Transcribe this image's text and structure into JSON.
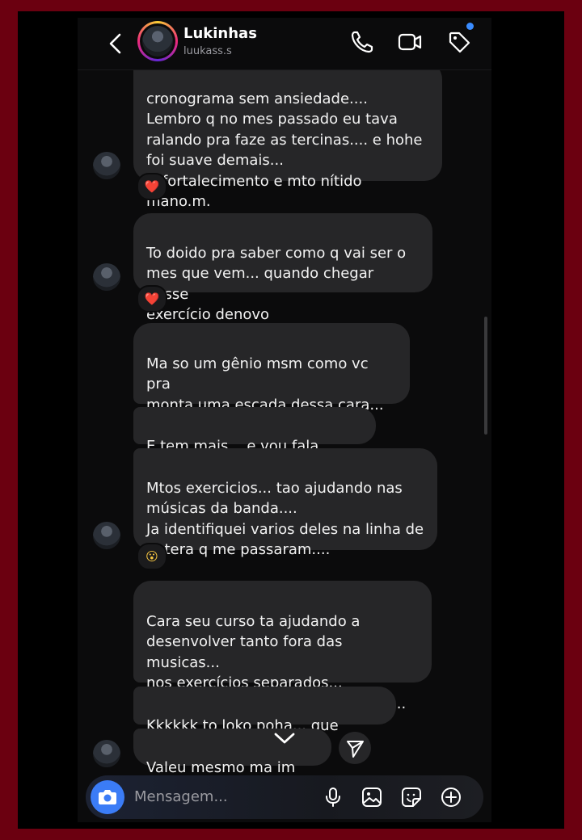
{
  "header": {
    "name": "Lukinhas",
    "handle": "luukass.s"
  },
  "messages": [
    {
      "text": "cronograma sem ansiedade....\nLembro q no mes passado eu tava\nralando pra faze as tercinas.... e hohe\nfoi suave demais...\nO fortalecimento e mto nítido mano.m."
    },
    {
      "text": "To doido pra saber como q vai ser o\nmes que vem... quando chegar nesse\nexercício denovo"
    },
    {
      "text": "Ma so um gênio msm como vc pra\nmonta uma escada dessa cara...\nnamoral.."
    },
    {
      "text": "E tem mais... e vou fala msm..."
    },
    {
      "text": "Mtos exercicios... tao ajudando nas\nmúsicas da banda....\nJa identifiquei varios deles na linha de\nbatera q me passaram...."
    },
    {
      "text": "Cara seu curso ta ajudando a\ndesenvolver tanto fora das musicas...\nnos exercícios separados...\nQuanto dentro das musicas mano..."
    },
    {
      "text": "Kkkkkk to loko poha... que lokura"
    },
    {
      "text": "Valeu mesmo ma   im"
    }
  ],
  "reactions": [
    "❤️",
    "❤️",
    "😮"
  ],
  "composer": {
    "placeholder": "Mensagem..."
  },
  "colors": {
    "bubble": "#262628",
    "background": "#0b0b0c",
    "accent_blue": "#3b7cf6",
    "frame": "#6b0010"
  },
  "icons": [
    "back-arrow-icon",
    "phone-icon",
    "video-camera-icon",
    "tag-icon",
    "camera-icon",
    "microphone-icon",
    "gallery-icon",
    "sticker-icon",
    "plus-icon",
    "chevron-down-icon",
    "send-icon"
  ]
}
